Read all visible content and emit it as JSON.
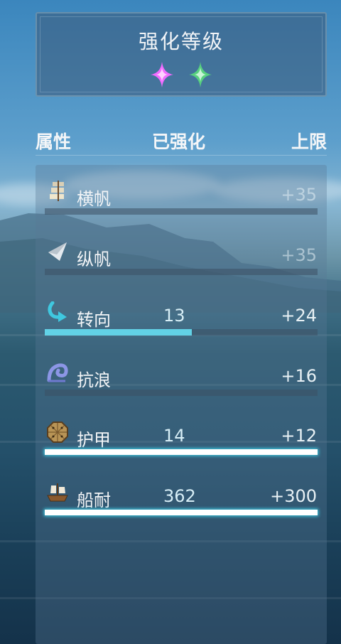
{
  "title": "强化等级",
  "stars": [
    {
      "icon": "pink-sparkle-icon",
      "color": "#f06bff"
    },
    {
      "icon": "green-sparkle-icon",
      "color": "#57d07f"
    }
  ],
  "headers": {
    "attribute": "属性",
    "enhanced": "已强化",
    "limit": "上限"
  },
  "rows": [
    {
      "name": "横帆",
      "icon": "square-sail-icon",
      "value": "",
      "limit": "+35",
      "progress": 0
    },
    {
      "name": "纵帆",
      "icon": "fore-and-aft-sail-icon",
      "value": "",
      "limit": "+35",
      "progress": 0
    },
    {
      "name": "转向",
      "icon": "turn-arrow-icon",
      "value": "13",
      "limit": "+24",
      "progress": 0.54
    },
    {
      "name": "抗浪",
      "icon": "wave-icon",
      "value": "",
      "limit": "+16",
      "progress": 0
    },
    {
      "name": "护甲",
      "icon": "armor-plate-icon",
      "value": "14",
      "limit": "+12",
      "progress": 1
    },
    {
      "name": "船耐",
      "icon": "ship-icon",
      "value": "362",
      "limit": "+300",
      "progress": 1
    }
  ]
}
